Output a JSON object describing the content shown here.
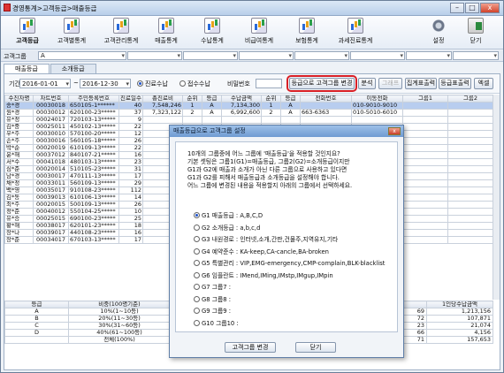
{
  "window": {
    "title": "경영통계>고객등급>매출등급"
  },
  "toolbar": [
    "고객등급",
    "고객별통계",
    "고객관리통계",
    "매출통계",
    "수납통계",
    "비급여통계",
    "보험통계",
    "과세진료통계",
    "설정",
    "닫기"
  ],
  "filter": {
    "label": "고객그룹",
    "value": "A"
  },
  "tabs": [
    "매출등급",
    "소개등급"
  ],
  "controls": {
    "period_label": "기간",
    "date_from": "2016-01-01",
    "tilde": "~",
    "date_to": "2016-12-30",
    "radio1": "진료수납",
    "radio2": "접수수납",
    "pw_label": "비밀번호",
    "btn_change": "등급으로 고객그룹 변경",
    "btn_analyze": "분석",
    "btn_graph": "그래프",
    "btn_sum_print": "집계표출력",
    "btn_grade_print": "등급표출력",
    "btn_excel": "엑셀"
  },
  "grid": {
    "headers": [
      "수진자명",
      "차트번호",
      "주민등록번호",
      "진료일수",
      "총진료비",
      "순위",
      "등급",
      "수납금액",
      "순위",
      "등급",
      "전화번호",
      "이동전화",
      "그룹1",
      "그룹2"
    ],
    "rows": [
      [
        "송*경",
        "00030018",
        "650105-1******",
        "40",
        "7,548,246",
        "1",
        "A",
        "7,134,300",
        "1",
        "A",
        "",
        "010-9010-9010",
        "",
        ""
      ],
      [
        "원*경",
        "00030012",
        "620100-23*****",
        "37",
        "7,323,122",
        "2",
        "A",
        "6,992,600",
        "2",
        "A",
        "663-6363",
        "010-5010-6010",
        "",
        ""
      ],
      [
        "유*정",
        "00024017",
        "720103-13*****",
        "9",
        "",
        "",
        "",
        "",
        "",
        "",
        "",
        "",
        "",
        ""
      ],
      [
        "김*중",
        "00025011",
        "450102-13*****",
        "22",
        "",
        "",
        "",
        "",
        "",
        "",
        "",
        "",
        "",
        ""
      ],
      [
        "우*주",
        "00030010",
        "570100-20*****",
        "12",
        "",
        "",
        "",
        "",
        "",
        "",
        "",
        "",
        "",
        ""
      ],
      [
        "손*주",
        "00030016",
        "560105-18*****",
        "26",
        "",
        "",
        "",
        "",
        "",
        "",
        "",
        "",
        "",
        ""
      ],
      [
        "박*순",
        "00020019",
        "610109-13*****",
        "22",
        "",
        "",
        "",
        "",
        "",
        "",
        "",
        "",
        "",
        ""
      ],
      [
        "윤*해",
        "00037012",
        "840107-21*****",
        "16",
        "",
        "",
        "",
        "",
        "",
        "",
        "",
        "",
        "",
        ""
      ],
      [
        "서*수",
        "00041018",
        "480103-13*****",
        "23",
        "",
        "",
        "",
        "",
        "",
        "",
        "",
        "",
        "",
        ""
      ],
      [
        "심*준",
        "00020014",
        "510105-23*****",
        "31",
        "",
        "",
        "",
        "",
        "",
        "",
        "",
        "",
        "",
        ""
      ],
      [
        "남*경",
        "00030017",
        "470111-13*****",
        "17",
        "",
        "",
        "",
        "",
        "",
        "",
        "",
        "",
        "",
        ""
      ],
      [
        "채*정",
        "00033011",
        "560109-13*****",
        "29",
        "",
        "",
        "",
        "",
        "",
        "",
        "",
        "",
        "",
        ""
      ],
      [
        "백*영",
        "00035017",
        "910108-23*****",
        "112",
        "",
        "",
        "",
        "",
        "",
        "",
        "",
        "",
        "",
        ""
      ],
      [
        "김*동",
        "00039013",
        "610106-13*****",
        "14",
        "",
        "",
        "",
        "",
        "",
        "",
        "",
        "",
        "",
        ""
      ],
      [
        "최*주",
        "00020015",
        "500109-13*****",
        "26",
        "",
        "",
        "",
        "",
        "",
        "",
        "",
        "",
        "",
        ""
      ],
      [
        "정*준",
        "00040012",
        "550104-25*****",
        "10",
        "",
        "",
        "",
        "",
        "",
        "",
        "",
        "",
        "",
        ""
      ],
      [
        "유*승",
        "00025015",
        "690100-23*****",
        "25",
        "",
        "",
        "",
        "",
        "",
        "",
        "",
        "",
        "",
        ""
      ],
      [
        "황*해",
        "00038017",
        "620101-23*****",
        "18",
        "",
        "",
        "",
        "",
        "",
        "",
        "",
        "",
        "",
        ""
      ],
      [
        "장*나",
        "00039017",
        "440108-23*****",
        "16",
        "",
        "",
        "",
        "",
        "",
        "",
        "",
        "",
        "",
        ""
      ],
      [
        "장*준",
        "00034017",
        "670103-13*****",
        "17",
        "",
        "",
        "",
        "",
        "",
        "",
        "",
        "",
        "",
        ""
      ]
    ]
  },
  "summary": {
    "headers": [
      "등급",
      "비중(100명기준)",
      "",
      "1인당수납금액"
    ],
    "rows": [
      [
        "A",
        "10%(1~10등)",
        "69",
        "1,213,156"
      ],
      [
        "B",
        "20%(11~30등)",
        "72",
        "107,871"
      ],
      [
        "C",
        "30%(31~60등)",
        "23",
        "21,074"
      ],
      [
        "D",
        "40%(61~100등)",
        "66",
        "4,156"
      ],
      [
        "",
        "전체(100%)",
        "71",
        "157,653"
      ]
    ]
  },
  "dialog": {
    "title": "매출등급으로 고객그룹 설정",
    "close": "x",
    "desc": [
      "10개의 그룹중에 어느 그룹에 '매출등급'을 적용할 것인지요?",
      "기본 셋팅은 그룹1(G1)=매출등급, 그룹2(G2)=소개등급이지만",
      "G1과 G2에 매출과 소개가 아닌 다른 그룹으로 사용하고 있다면",
      "G1과 G2를 피해서 매출등급과 소개등급을 설정해야 합니다.",
      "어느 그룹에 변경된 내용을 적용할지 아래의 그룹에서 선택하세요."
    ],
    "options": [
      "G1 매출등급 : A,B,C,D",
      "G2 소개등급 : a,b,c,d",
      "G3 내원경로 : 인터넷,소개,간판,건물주,지역유지,기타",
      "G4 예약준수 : KA-keep,CA-cancle,BA-broken",
      "G5 특별관리 : VIP,EMG-emergency,CMP-complain,BLK-blacklist",
      "G6 임플란트 : IMend,IMing,IMstp,IMgup,IMpin",
      "G7 그룹7 :",
      "G8 그룹8 :",
      "G9 그룹9 :",
      "G10 그룹10 :"
    ],
    "btn_change": "고객그룹 변경",
    "btn_close": "닫기"
  }
}
